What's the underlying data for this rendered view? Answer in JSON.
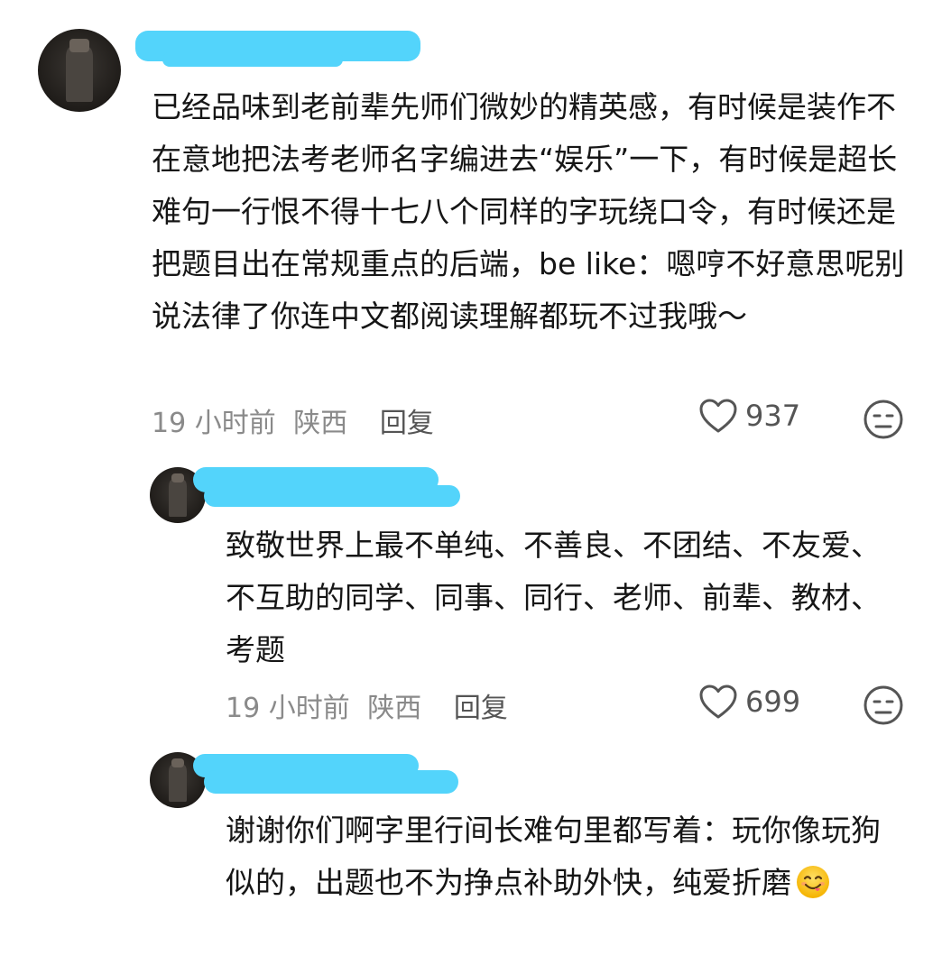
{
  "comments": [
    {
      "text": "已经品味到老前辈先师们微妙的精英感，有时候是装作不在意地把法考老师名字编进去“娱乐”一下，有时候是超长难句一行恨不得十七八个同样的字玩绕口令，有时候还是把题目出在常规重点的后端，be like：嗯哼不好意思呢别说法律了你连中文都阅读理解都玩不过我哦～",
      "time": "19 小时前",
      "location": "陕西",
      "reply_label": "回复",
      "likes": "937"
    },
    {
      "text": "致敬世界上最不单纯、不善良、不团结、不友爱、不互助的同学、同事、同行、老师、前辈、教材、考题",
      "time": "19 小时前",
      "location": "陕西",
      "reply_label": "回复",
      "likes": "699"
    },
    {
      "text": "谢谢你们啊字里行间长难句里都写着：玩你像玩狗似的，出题也不为挣点补助外快，纯爱折磨",
      "emoji": "yum-face-emoji"
    }
  ],
  "icons": {
    "like": "heart-outline-icon",
    "dislike": "unhappy-face-icon"
  },
  "colors": {
    "redaction": "#53d4fb",
    "meta_text": "#8a8a8a",
    "body_text": "#161616"
  }
}
